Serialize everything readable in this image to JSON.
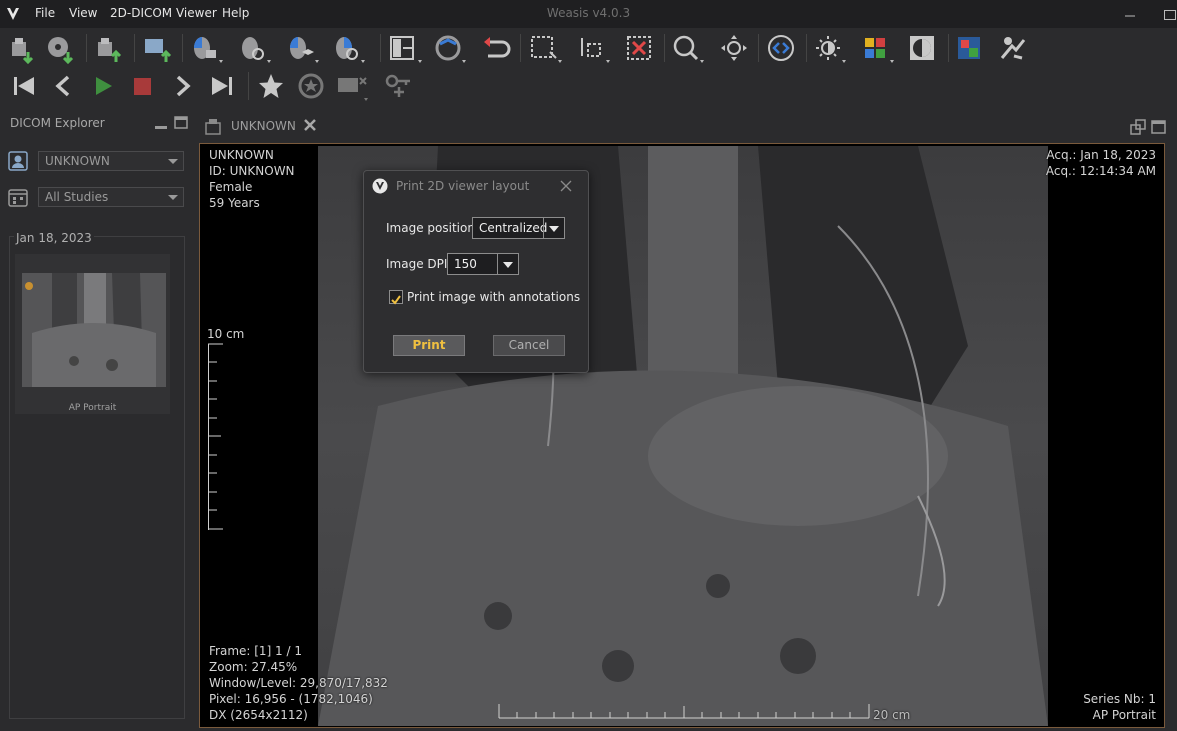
{
  "menubar": {
    "items": [
      "File",
      "View",
      "2D-DICOM Viewer",
      "Help"
    ],
    "title": "Weasis v4.0.3"
  },
  "toolbar": {
    "row1_icons": [
      "import-dicom-icon",
      "import-cd-icon",
      "export-dicom-icon",
      "export-image-icon",
      "mouse-left-action-icon",
      "mouse-zoom-action-icon",
      "mouse-layers-action-icon",
      "mouse-middle-action-icon",
      "layout-icon",
      "synch-icon",
      "reset-icon",
      "select-area-icon",
      "measure-icon",
      "delete-measure-icon",
      "zoom-icon",
      "pan-icon",
      "orientation-icon",
      "window-level-icon",
      "lut-icon",
      "invert-icon",
      "screenshot-icon",
      "dicom-info-icon"
    ],
    "row2_icons": [
      "first-frame-icon",
      "previous-frame-icon",
      "play-icon",
      "stop-icon",
      "next-frame-icon",
      "last-frame-icon",
      "favorite-icon",
      "rotate-icon",
      "cross-lines-icon",
      "key-image-icon"
    ]
  },
  "explorer": {
    "title": "DICOM Explorer",
    "patient_select": "UNKNOWN",
    "studies_select": "All Studies",
    "study_date": "Jan 18, 2023",
    "series_label": "AP Portrait"
  },
  "tab": {
    "label": "UNKNOWN"
  },
  "viewer": {
    "patient_name": "UNKNOWN",
    "patient_id": "ID: UNKNOWN",
    "sex": "Female",
    "age": "59 Years",
    "acq_date": "Acq.: Jan 18, 2023",
    "acq_time": "Acq.: 12:14:34 AM",
    "scale_v_label": "10 cm",
    "scale_h_label": "20 cm",
    "frame": "Frame: [1] 1 / 1",
    "zoom": "Zoom: 27.45%",
    "window_level": "Window/Level: 29,870/17,832",
    "pixel": "Pixel: 16,956 - (1782,1046)",
    "modality": "DX (2654x2112)",
    "series_nb": "Series Nb: 1",
    "series_desc": "AP Portrait"
  },
  "dialog": {
    "title": "Print 2D viewer layout",
    "position_label": "Image position:",
    "position_value": "Centralized",
    "dpi_label": "Image DPI:",
    "dpi_value": "150",
    "annotations_label": "Print image with annotations",
    "annotations_checked": true,
    "print_label": "Print",
    "cancel_label": "Cancel"
  },
  "colors": {
    "accent": "#f0c040",
    "viewer_border": "#7a5a3c",
    "background": "#2b2b2d"
  }
}
